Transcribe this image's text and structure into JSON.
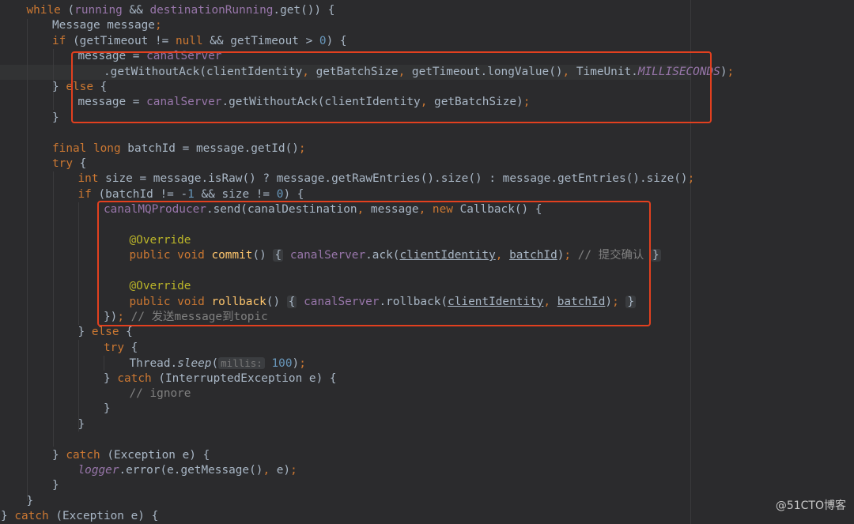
{
  "editor": {
    "lines": [
      {
        "indent": 1,
        "tokens": [
          {
            "t": "while",
            "c": "kw"
          },
          {
            "t": " ("
          },
          {
            "t": "running",
            "c": "fld"
          },
          {
            "t": " && "
          },
          {
            "t": "destinationRunning",
            "c": "fld"
          },
          {
            "t": ".get()) {"
          }
        ]
      },
      {
        "indent": 2,
        "tokens": [
          {
            "t": "Message message"
          },
          {
            "t": ";",
            "c": "kw"
          }
        ]
      },
      {
        "indent": 2,
        "tokens": [
          {
            "t": "if",
            "c": "kw"
          },
          {
            "t": " (getTimeout != "
          },
          {
            "t": "null",
            "c": "kw"
          },
          {
            "t": " && getTimeout > "
          },
          {
            "t": "0",
            "c": "num"
          },
          {
            "t": ") {"
          }
        ]
      },
      {
        "indent": 3,
        "tokens": [
          {
            "t": "message = "
          },
          {
            "t": "canalServer",
            "c": "fld"
          }
        ]
      },
      {
        "indent": 4,
        "tokens": [
          {
            "t": ".getWithoutAck(clientIdentity"
          },
          {
            "t": ",",
            "c": "kw"
          },
          {
            "t": " getBatchSize"
          },
          {
            "t": ",",
            "c": "kw"
          },
          {
            "t": " getTimeout.longValue()"
          },
          {
            "t": ",",
            "c": "kw"
          },
          {
            "t": " TimeUnit."
          },
          {
            "t": "MILLISECONDS",
            "c": "fldi"
          },
          {
            "t": ")"
          },
          {
            "t": ";",
            "c": "kw"
          }
        ]
      },
      {
        "indent": 2,
        "tokens": [
          {
            "t": "} "
          },
          {
            "t": "else",
            "c": "kw"
          },
          {
            "t": " {"
          }
        ]
      },
      {
        "indent": 3,
        "tokens": [
          {
            "t": "message = "
          },
          {
            "t": "canalServer",
            "c": "fld"
          },
          {
            "t": ".getWithoutAck(clientIdentity"
          },
          {
            "t": ",",
            "c": "kw"
          },
          {
            "t": " getBatchSize)"
          },
          {
            "t": ";",
            "c": "kw"
          }
        ]
      },
      {
        "indent": 2,
        "tokens": [
          {
            "t": "}"
          }
        ]
      },
      {
        "indent": 0,
        "tokens": []
      },
      {
        "indent": 2,
        "tokens": [
          {
            "t": "final long",
            "c": "kw"
          },
          {
            "t": " batchId = message.getId()"
          },
          {
            "t": ";",
            "c": "kw"
          }
        ]
      },
      {
        "indent": 2,
        "tokens": [
          {
            "t": "try",
            "c": "kw"
          },
          {
            "t": " {"
          }
        ]
      },
      {
        "indent": 3,
        "tokens": [
          {
            "t": "int",
            "c": "kw"
          },
          {
            "t": " size = message.isRaw() ? message.getRawEntries().size() : message.getEntries().size()"
          },
          {
            "t": ";",
            "c": "kw"
          }
        ]
      },
      {
        "indent": 3,
        "tokens": [
          {
            "t": "if",
            "c": "kw"
          },
          {
            "t": " (batchId != -"
          },
          {
            "t": "1",
            "c": "num"
          },
          {
            "t": " && size != "
          },
          {
            "t": "0",
            "c": "num"
          },
          {
            "t": ") {"
          }
        ]
      },
      {
        "indent": 4,
        "tokens": [
          {
            "t": "canalMQProducer",
            "c": "fld"
          },
          {
            "t": ".send(canalDestination"
          },
          {
            "t": ",",
            "c": "kw"
          },
          {
            "t": " message"
          },
          {
            "t": ",",
            "c": "kw"
          },
          {
            "t": " "
          },
          {
            "t": "new",
            "c": "kw"
          },
          {
            "t": " Callback() {"
          }
        ]
      },
      {
        "indent": 0,
        "tokens": []
      },
      {
        "indent": 5,
        "tokens": [
          {
            "t": "@Override",
            "c": "ann"
          }
        ]
      },
      {
        "indent": 5,
        "tokens": [
          {
            "t": "public void",
            "c": "kw"
          },
          {
            "t": " "
          },
          {
            "t": "commit",
            "c": "fn"
          },
          {
            "t": "() "
          },
          {
            "t": "{",
            "c": "fold"
          },
          {
            "t": " "
          },
          {
            "t": "canalServer",
            "c": "fld"
          },
          {
            "t": ".ack("
          },
          {
            "t": "clientIdentity",
            "c": "under"
          },
          {
            "t": ",",
            "c": "kw"
          },
          {
            "t": " "
          },
          {
            "t": "batchId",
            "c": "under"
          },
          {
            "t": ")"
          },
          {
            "t": ";",
            "c": "kw"
          },
          {
            "t": " "
          },
          {
            "t": "// 提交确认",
            "c": "cmt"
          },
          {
            "t": " "
          },
          {
            "t": "}",
            "c": "fold"
          }
        ]
      },
      {
        "indent": 0,
        "tokens": []
      },
      {
        "indent": 5,
        "tokens": [
          {
            "t": "@Override",
            "c": "ann"
          }
        ]
      },
      {
        "indent": 5,
        "tokens": [
          {
            "t": "public void",
            "c": "kw"
          },
          {
            "t": " "
          },
          {
            "t": "rollback",
            "c": "fn"
          },
          {
            "t": "() "
          },
          {
            "t": "{",
            "c": "fold"
          },
          {
            "t": " "
          },
          {
            "t": "canalServer",
            "c": "fld"
          },
          {
            "t": ".rollback("
          },
          {
            "t": "clientIdentity",
            "c": "under"
          },
          {
            "t": ",",
            "c": "kw"
          },
          {
            "t": " "
          },
          {
            "t": "batchId",
            "c": "under"
          },
          {
            "t": ")"
          },
          {
            "t": ";",
            "c": "kw"
          },
          {
            "t": " "
          },
          {
            "t": "}",
            "c": "fold"
          }
        ]
      },
      {
        "indent": 4,
        "tokens": [
          {
            "t": "})"
          },
          {
            "t": ";",
            "c": "kw"
          },
          {
            "t": " "
          },
          {
            "t": "// 发送message到topic",
            "c": "cmt"
          }
        ]
      },
      {
        "indent": 3,
        "tokens": [
          {
            "t": "} "
          },
          {
            "t": "else",
            "c": "kw"
          },
          {
            "t": " {"
          }
        ]
      },
      {
        "indent": 4,
        "tokens": [
          {
            "t": "try",
            "c": "kw"
          },
          {
            "t": " {"
          }
        ]
      },
      {
        "indent": 5,
        "tokens": [
          {
            "t": "Thread."
          },
          {
            "t": "sleep",
            "c": "ital"
          },
          {
            "t": "("
          },
          {
            "t": "millis:",
            "c": "hint"
          },
          {
            "t": " "
          },
          {
            "t": "100",
            "c": "num"
          },
          {
            "t": ")"
          },
          {
            "t": ";",
            "c": "kw"
          }
        ]
      },
      {
        "indent": 4,
        "tokens": [
          {
            "t": "} "
          },
          {
            "t": "catch",
            "c": "kw"
          },
          {
            "t": " (InterruptedException e) {"
          }
        ]
      },
      {
        "indent": 5,
        "tokens": [
          {
            "t": "// ignore",
            "c": "cmt"
          }
        ]
      },
      {
        "indent": 4,
        "tokens": [
          {
            "t": "}"
          }
        ]
      },
      {
        "indent": 3,
        "tokens": [
          {
            "t": "}"
          }
        ]
      },
      {
        "indent": 0,
        "tokens": []
      },
      {
        "indent": 2,
        "tokens": [
          {
            "t": "} "
          },
          {
            "t": "catch",
            "c": "kw"
          },
          {
            "t": " (Exception e) {"
          }
        ]
      },
      {
        "indent": 3,
        "tokens": [
          {
            "t": "logger",
            "c": "fldi"
          },
          {
            "t": ".error(e.getMessage()"
          },
          {
            "t": ",",
            "c": "kw"
          },
          {
            "t": " e)"
          },
          {
            "t": ";",
            "c": "kw"
          }
        ]
      },
      {
        "indent": 2,
        "tokens": [
          {
            "t": "}"
          }
        ]
      },
      {
        "indent": 1,
        "tokens": [
          {
            "t": "}"
          }
        ]
      },
      {
        "indent": 0,
        "tokens": [
          {
            "t": "} "
          },
          {
            "t": "catch",
            "c": "kw"
          },
          {
            "t": " (Exception e) {"
          }
        ]
      }
    ]
  },
  "watermark": "@51CTO博客",
  "colors": {
    "background": "#2b2b2d",
    "keyword": "#cc7832",
    "field": "#9876aa",
    "method": "#ffc66d",
    "annotation": "#bbb529",
    "comment": "#808080",
    "number": "#6897bb",
    "text": "#a9b7c6",
    "highlight_box": "#e2401f"
  }
}
